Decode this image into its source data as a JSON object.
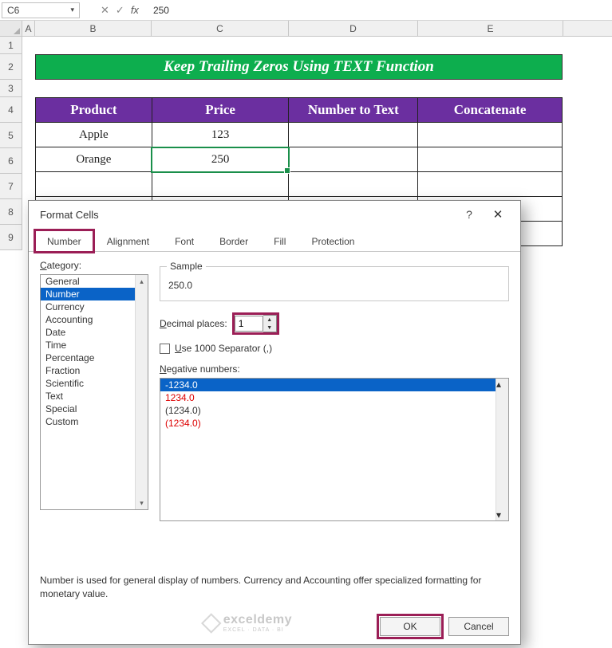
{
  "formula_bar": {
    "cell_ref": "C6",
    "formula_value": "250",
    "fx_label": "fx"
  },
  "columns": {
    "A": "A",
    "B": "B",
    "C": "C",
    "D": "D",
    "E": "E"
  },
  "rows": [
    "1",
    "2",
    "3",
    "4",
    "5",
    "6",
    "7",
    "8",
    "9"
  ],
  "sheet": {
    "title": "Keep Trailing Zeros Using TEXT Function",
    "headers": {
      "product": "Product",
      "price": "Price",
      "n2t": "Number to Text",
      "concat": "Concatenate"
    },
    "data": [
      {
        "product": "Apple",
        "price": "123",
        "n2t": "",
        "concat": ""
      },
      {
        "product": "Orange",
        "price": "250",
        "n2t": "",
        "concat": ""
      }
    ]
  },
  "dialog": {
    "title": "Format Cells",
    "help": "?",
    "close": "✕",
    "tabs": {
      "number": "Number",
      "alignment": "Alignment",
      "font": "Font",
      "border": "Border",
      "fill": "Fill",
      "protection": "Protection"
    },
    "category_label": "Category:",
    "categories": [
      "General",
      "Number",
      "Currency",
      "Accounting",
      "Date",
      "Time",
      "Percentage",
      "Fraction",
      "Scientific",
      "Text",
      "Special",
      "Custom"
    ],
    "selected_category": "Number",
    "sample_label": "Sample",
    "sample_value": "250.0",
    "decimal_label": "Decimal places:",
    "decimal_value": "1",
    "sep_label": "Use 1000 Separator (,)",
    "neg_label": "Negative numbers:",
    "neg_options": [
      {
        "text": "-1234.0",
        "sel": true,
        "red": false
      },
      {
        "text": "1234.0",
        "sel": false,
        "red": true
      },
      {
        "text": "(1234.0)",
        "sel": false,
        "red": false
      },
      {
        "text": "(1234.0)",
        "sel": false,
        "red": true
      }
    ],
    "description": "Number is used for general display of numbers.  Currency and Accounting offer specialized formatting for monetary value.",
    "ok": "OK",
    "cancel": "Cancel",
    "watermark_brand": "exceldemy",
    "watermark_tag": "EXCEL · DATA · BI"
  }
}
